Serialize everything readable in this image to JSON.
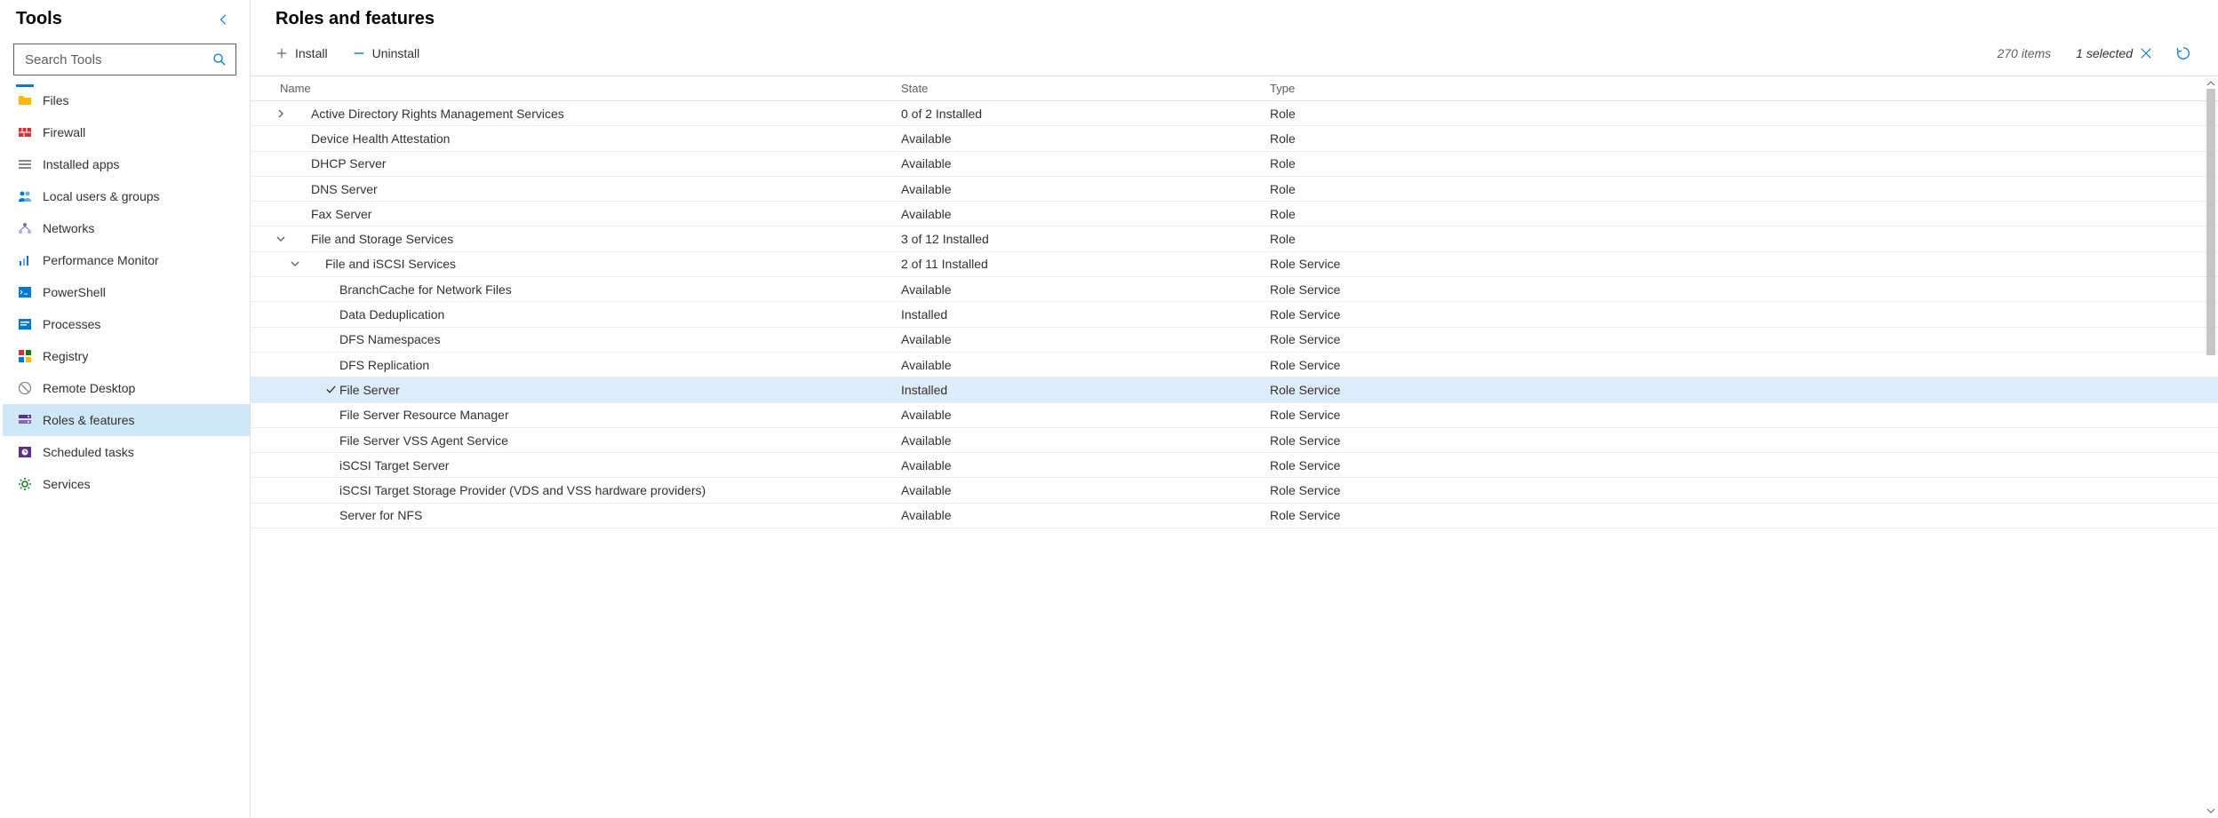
{
  "sidebar": {
    "title": "Tools",
    "search_placeholder": "Search Tools",
    "items": [
      {
        "label": "Files",
        "icon": "folder",
        "color": "#ffb900"
      },
      {
        "label": "Firewall",
        "icon": "firewall",
        "color": "#d13438"
      },
      {
        "label": "Installed apps",
        "icon": "apps",
        "color": "#605e5c"
      },
      {
        "label": "Local users & groups",
        "icon": "users",
        "color": "#0078d4"
      },
      {
        "label": "Networks",
        "icon": "network",
        "color": "#8764b8"
      },
      {
        "label": "Performance Monitor",
        "icon": "perf",
        "color": "#0078d4"
      },
      {
        "label": "PowerShell",
        "icon": "terminal",
        "color": "#0078d4"
      },
      {
        "label": "Processes",
        "icon": "process",
        "color": "#0078d4"
      },
      {
        "label": "Registry",
        "icon": "registry",
        "color": "#107c10"
      },
      {
        "label": "Remote Desktop",
        "icon": "remote",
        "color": "#8a8886"
      },
      {
        "label": "Roles & features",
        "icon": "roles",
        "color": "#5c2e91",
        "selected": true
      },
      {
        "label": "Scheduled tasks",
        "icon": "tasks",
        "color": "#5c2e91"
      },
      {
        "label": "Services",
        "icon": "services",
        "color": "#107c10"
      }
    ]
  },
  "main": {
    "title": "Roles and features",
    "install_label": "Install",
    "uninstall_label": "Uninstall",
    "item_count": "270 items",
    "selected_count": "1 selected",
    "columns": {
      "name": "Name",
      "state": "State",
      "type": "Type"
    },
    "rows": [
      {
        "level": 0,
        "expander": "right",
        "name": "Active Directory Rights Management Services",
        "state": "0 of 2 Installed",
        "type": "Role"
      },
      {
        "level": 0,
        "name": "Device Health Attestation",
        "state": "Available",
        "type": "Role"
      },
      {
        "level": 0,
        "name": "DHCP Server",
        "state": "Available",
        "type": "Role"
      },
      {
        "level": 0,
        "name": "DNS Server",
        "state": "Available",
        "type": "Role"
      },
      {
        "level": 0,
        "name": "Fax Server",
        "state": "Available",
        "type": "Role"
      },
      {
        "level": 0,
        "expander": "down",
        "name": "File and Storage Services",
        "state": "3 of 12 Installed",
        "type": "Role"
      },
      {
        "level": 1,
        "expander": "down",
        "name": "File and iSCSI Services",
        "state": "2 of 11 Installed",
        "type": "Role Service"
      },
      {
        "level": 2,
        "name": "BranchCache for Network Files",
        "state": "Available",
        "type": "Role Service"
      },
      {
        "level": 2,
        "name": "Data Deduplication",
        "state": "Installed",
        "type": "Role Service"
      },
      {
        "level": 2,
        "name": "DFS Namespaces",
        "state": "Available",
        "type": "Role Service"
      },
      {
        "level": 2,
        "name": "DFS Replication",
        "state": "Available",
        "type": "Role Service"
      },
      {
        "level": 2,
        "name": "File Server",
        "state": "Installed",
        "type": "Role Service",
        "selected": true,
        "checked": true
      },
      {
        "level": 2,
        "name": "File Server Resource Manager",
        "state": "Available",
        "type": "Role Service"
      },
      {
        "level": 2,
        "name": "File Server VSS Agent Service",
        "state": "Available",
        "type": "Role Service"
      },
      {
        "level": 2,
        "name": "iSCSI Target Server",
        "state": "Available",
        "type": "Role Service"
      },
      {
        "level": 2,
        "name": "iSCSI Target Storage Provider (VDS and VSS hardware providers)",
        "state": "Available",
        "type": "Role Service"
      },
      {
        "level": 2,
        "name": "Server for NFS",
        "state": "Available",
        "type": "Role Service"
      }
    ]
  }
}
